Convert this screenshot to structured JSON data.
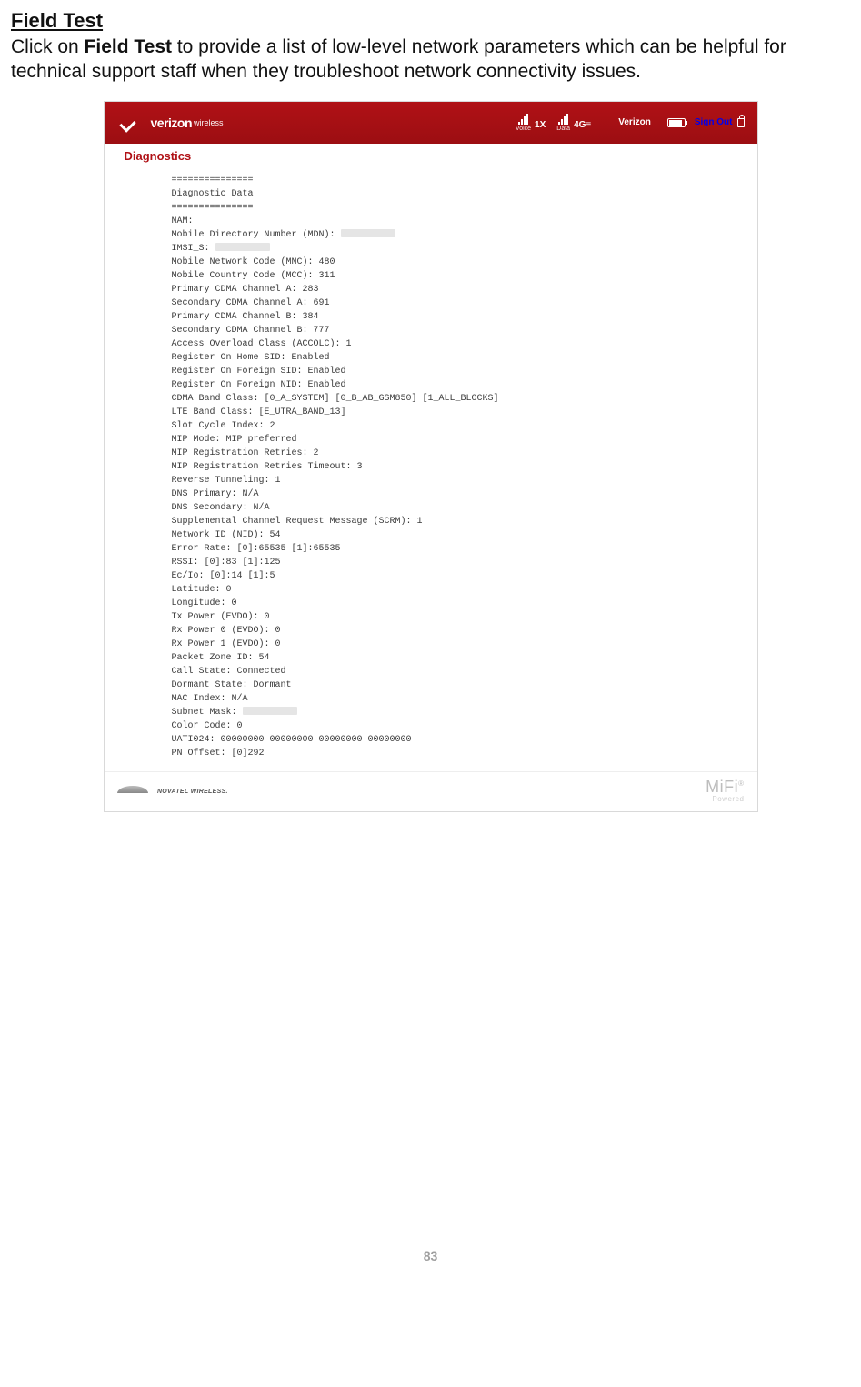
{
  "page": {
    "heading": "Field Test",
    "intro_pre": "Click on ",
    "intro_bold": "Field Test",
    "intro_post": " to provide a list of low-level network parameters which can be helpful for technical support staff when they troubleshoot network connectivity issues.",
    "number": "83"
  },
  "topbar": {
    "logo_main": "verizon",
    "logo_sub": "wireless",
    "voice_caption": "Voice",
    "voice_label": "1X",
    "data_caption": "Data",
    "data_label": "4G≡",
    "carrier": "Verizon",
    "signout": "Sign Out"
  },
  "diag": {
    "title": "Diagnostics",
    "lines": [
      "===============",
      "Diagnostic Data",
      "===============",
      "",
      "NAM:",
      "Mobile Directory Number (MDN): ",
      "IMSI_S: ",
      "Mobile Network Code (MNC): 480",
      "Mobile Country Code (MCC): 311",
      "Primary CDMA Channel A: 283",
      "Secondary CDMA Channel A: 691",
      "Primary CDMA Channel B: 384",
      "Secondary CDMA Channel B: 777",
      "Access Overload Class (ACCOLC): 1",
      "Register On Home SID: Enabled",
      "Register On Foreign SID: Enabled",
      "Register On Foreign NID: Enabled",
      "CDMA Band Class: [0_A_SYSTEM] [0_B_AB_GSM850] [1_ALL_BLOCKS]",
      "LTE Band Class: [E_UTRA_BAND_13]",
      "Slot Cycle Index: 2",
      "MIP Mode: MIP preferred",
      "MIP Registration Retries: 2",
      "MIP Registration Retries Timeout: 3",
      "Reverse Tunneling: 1",
      "DNS Primary: N/A",
      "DNS Secondary: N/A",
      "Supplemental Channel Request Message (SCRM): 1",
      "Network ID (NID): 54",
      "Error Rate: [0]:65535 [1]:65535",
      "RSSI: [0]:83 [1]:125",
      "Ec/Io: [0]:14 [1]:5",
      "Latitude: 0",
      "Longitude: 0",
      "Tx Power (EVDO): 0",
      "Rx Power 0 (EVDO): 0",
      "Rx Power 1 (EVDO): 0",
      "Packet Zone ID: 54",
      "Call State: Connected",
      "Dormant State: Dormant",
      "MAC Index: N/A",
      "Subnet Mask: ",
      "Color Code: 0",
      "UATI024: 00000000 00000000 00000000 00000000",
      "PN Offset: [0]292"
    ],
    "redacted_lines": [
      5,
      6,
      40
    ]
  },
  "footer": {
    "novatel": "NOVATEL WIRELESS.",
    "mifi": "MiFi",
    "mifi_sup": "®",
    "mifi_sub": "Powered"
  }
}
